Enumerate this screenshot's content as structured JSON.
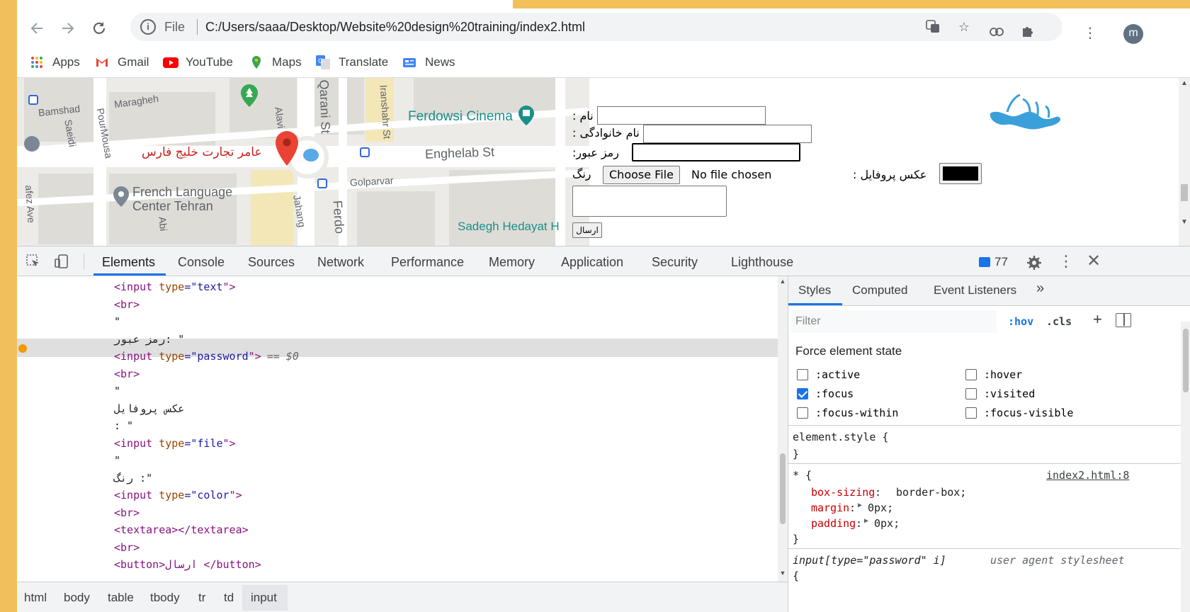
{
  "browser": {
    "url_prefix": "File",
    "url": "C:/Users/saaa/Desktop/Website%20design%20training/index2.html",
    "avatar_letter": "m",
    "bookmarks": [
      {
        "label": "Apps",
        "icon": "apps-grid-icon"
      },
      {
        "label": "Gmail",
        "icon": "gmail-icon"
      },
      {
        "label": "YouTube",
        "icon": "youtube-icon"
      },
      {
        "label": "Maps",
        "icon": "maps-pin-icon"
      },
      {
        "label": "Translate",
        "icon": "translate-icon"
      },
      {
        "label": "News",
        "icon": "news-icon"
      }
    ]
  },
  "map": {
    "marker_label": "عامر تجارت خلیج فارس",
    "labels": [
      "Maragheh",
      "Bamshad",
      "PourMousa",
      "Saeidi",
      "Alavi",
      "Qarani St",
      "Iranshahr St",
      "Ferdowsi Cinema",
      "Enghelab St",
      "Golparvar",
      "French Language",
      "Center Tehran",
      "afez Ave",
      "Jahang",
      "Ferdo",
      "Sadegh Hedayat H",
      "Abi"
    ]
  },
  "form": {
    "name_label": ": نام",
    "family_label": ": نام خانوادگی",
    "password_label": ":رمز عبور",
    "color_label": "رنگ",
    "choose_file": "Choose File",
    "no_file": "No file chosen",
    "profile_label": ": عکس پروفایل",
    "submit_label": "ارسال"
  },
  "devtools": {
    "tabs": [
      "Elements",
      "Console",
      "Sources",
      "Network",
      "Performance",
      "Memory",
      "Application",
      "Security",
      "Lighthouse"
    ],
    "issues_count": "77",
    "code_lines": [
      {
        "kind": "tag",
        "tag": "input",
        "attr": "type",
        "value": "text"
      },
      {
        "kind": "plain",
        "text": "<br>"
      },
      {
        "kind": "text",
        "text": "\""
      },
      {
        "kind": "text",
        "text": "رمز عبور: \""
      },
      {
        "kind": "tag",
        "tag": "input",
        "attr": "type",
        "value": "password",
        "suffix": "== $0"
      },
      {
        "kind": "plain",
        "text": "<br>"
      },
      {
        "kind": "text",
        "text": "\""
      },
      {
        "kind": "text",
        "text": "عکس پروفایل"
      },
      {
        "kind": "text",
        "text": ": \""
      },
      {
        "kind": "tag",
        "tag": "input",
        "attr": "type",
        "value": "file"
      },
      {
        "kind": "text",
        "text": "\""
      },
      {
        "kind": "text",
        "text": "رنگ :\""
      },
      {
        "kind": "tag",
        "tag": "input",
        "attr": "type",
        "value": "color"
      },
      {
        "kind": "plain",
        "text": "<br>"
      },
      {
        "kind": "plain",
        "text": "<textarea></textarea>"
      },
      {
        "kind": "plain",
        "text": "<br>"
      },
      {
        "kind": "plain",
        "text": "<button>ارسال </button>"
      }
    ],
    "breadcrumb": [
      "html",
      "body",
      "table",
      "tbody",
      "tr",
      "td",
      "input"
    ],
    "styles_tabs": [
      "Styles",
      "Computed",
      "Event Listeners"
    ],
    "filter_placeholder": "Filter",
    "hov": ":hov",
    "cls": ".cls",
    "force_state_title": "Force element state",
    "states": [
      {
        "label": ":active",
        "checked": false
      },
      {
        "label": ":hover",
        "checked": false
      },
      {
        "label": ":focus",
        "checked": true
      },
      {
        "label": ":visited",
        "checked": false
      },
      {
        "label": ":focus-within",
        "checked": false
      },
      {
        "label": ":focus-visible",
        "checked": false
      }
    ],
    "element_style": "element.style {",
    "close_brace": "}",
    "rule_selector": "* {",
    "rule_source": "index2.html:8",
    "rule_props": [
      {
        "name": "box-sizing",
        "value": "border-box;"
      },
      {
        "name": "margin",
        "value": "0px;"
      },
      {
        "name": "padding",
        "value": "0px;"
      }
    ],
    "ua_selector": "input[type=\"password\" i]",
    "ua_source": "user agent stylesheet",
    "ua_open": "{"
  }
}
